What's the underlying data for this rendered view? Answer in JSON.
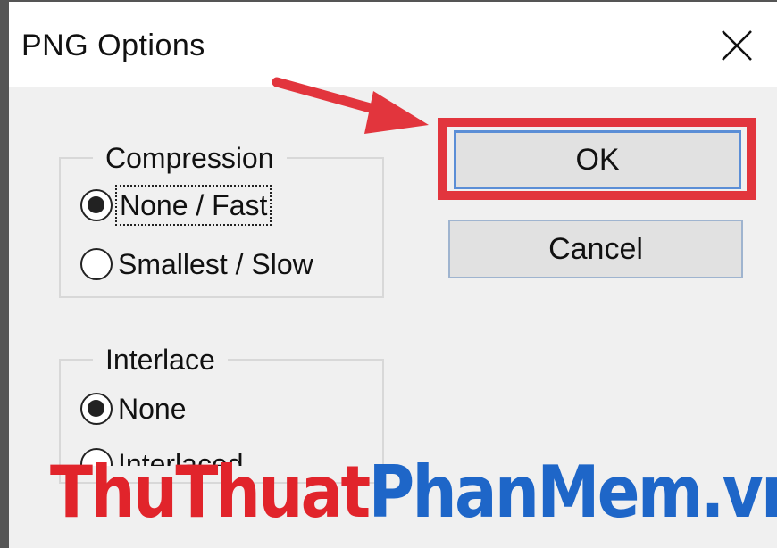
{
  "window": {
    "title": "PNG Options",
    "close_icon": "close-icon"
  },
  "compression": {
    "legend": "Compression",
    "options": [
      {
        "label": "None / Fast",
        "checked": true,
        "focused": true
      },
      {
        "label": "Smallest / Slow",
        "checked": false,
        "focused": false
      }
    ]
  },
  "interlace": {
    "legend": "Interlace",
    "options": [
      {
        "label": "None",
        "checked": true
      },
      {
        "label": "Interlaced",
        "checked": false
      }
    ]
  },
  "buttons": {
    "ok_label": "OK",
    "cancel_label": "Cancel"
  },
  "annotation": {
    "highlight_color": "#e2353d",
    "arrow_icon": "arrow-right-icon"
  },
  "watermark": {
    "red_text": "ThuThuat",
    "blue_text": "PhanMem.vn",
    "red_color": "#e1242b",
    "blue_color": "#1e66c8"
  }
}
